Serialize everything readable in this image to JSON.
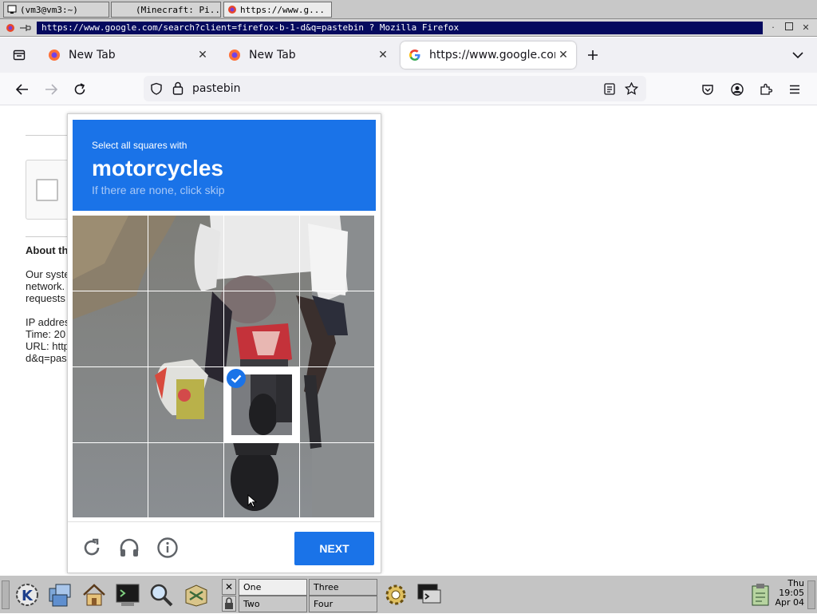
{
  "x11_taskbar": {
    "items": [
      {
        "label": "(vm3@vm3:~)"
      },
      {
        "label": "(Minecraft: Pi..."
      },
      {
        "label": "https://www.g..."
      }
    ]
  },
  "window": {
    "title": "https://www.google.com/search?client=firefox-b-1-d&q=pastebin ? Mozilla Firefox"
  },
  "tabs": [
    {
      "label": "New Tab",
      "icon": "firefox-icon"
    },
    {
      "label": "New Tab",
      "icon": "firefox-icon"
    },
    {
      "label": "https://www.google.com/",
      "icon": "google-icon"
    }
  ],
  "urlbar": {
    "value": "pastebin"
  },
  "background_page": {
    "about_heading": "About th",
    "lines": [
      "Our syste",
      "network.",
      "requests",
      "",
      "IP addres",
      "Time: 20",
      "URL: http",
      "d&q=pas"
    ]
  },
  "captcha": {
    "instruction": "Select all squares with",
    "target": "motorcycles",
    "hint": "If there are none, click skip",
    "next_label": "NEXT",
    "selected_tiles": 1
  },
  "panel": {
    "desktops": [
      "One",
      "Two",
      "Three",
      "Four"
    ],
    "clock": {
      "day": "Thu",
      "time": "19:05",
      "date": "Apr 04"
    }
  },
  "colors": {
    "captcha_blue": "#1a73e8",
    "title_bar": "#050a5e"
  }
}
